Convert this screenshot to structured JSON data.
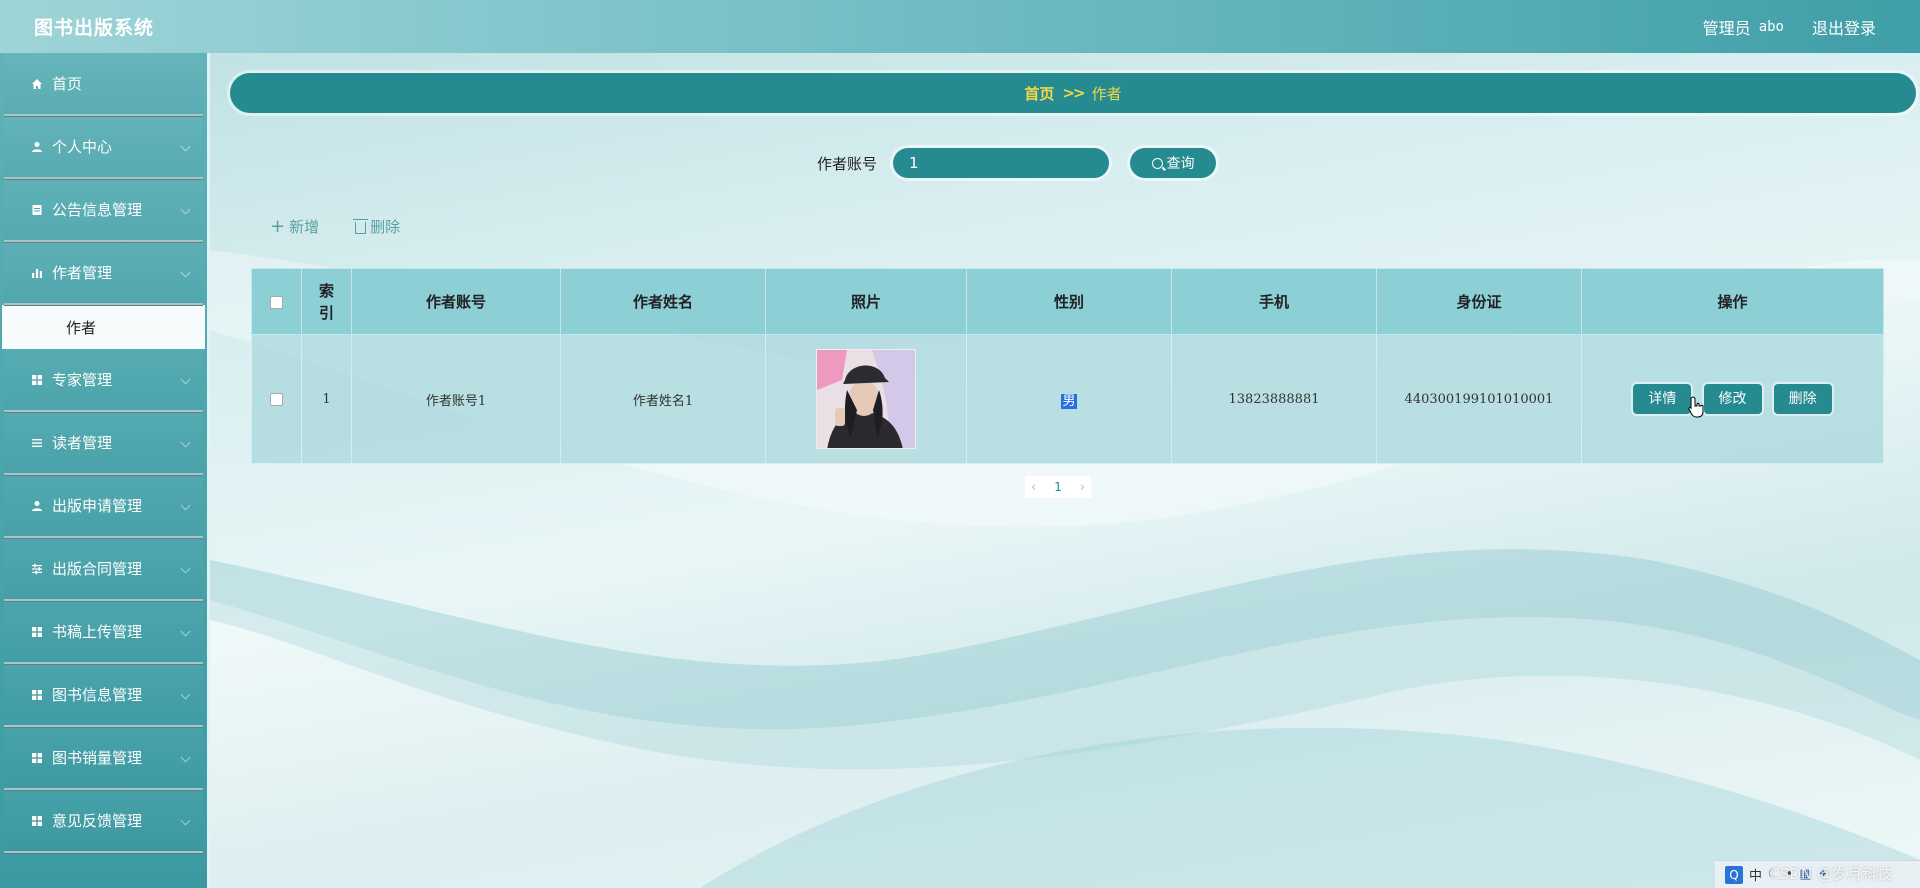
{
  "header": {
    "title": "图书出版系统",
    "admin_label": "管理员",
    "username": "abo",
    "logout": "退出登录"
  },
  "sidebar": {
    "items": [
      {
        "label": "首页",
        "icon": "home-icon",
        "expandable": false
      },
      {
        "label": "个人中心",
        "icon": "user-icon",
        "expandable": true
      },
      {
        "label": "公告信息管理",
        "icon": "document-icon",
        "expandable": true
      },
      {
        "label": "作者管理",
        "icon": "bar-chart-icon",
        "expandable": true,
        "expanded": true,
        "children": [
          {
            "label": "作者"
          }
        ]
      },
      {
        "label": "专家管理",
        "icon": "grid-icon",
        "expandable": true
      },
      {
        "label": "读者管理",
        "icon": "list-icon",
        "expandable": true
      },
      {
        "label": "出版申请管理",
        "icon": "user-icon",
        "expandable": true
      },
      {
        "label": "出版合同管理",
        "icon": "sliders-icon",
        "expandable": true
      },
      {
        "label": "书稿上传管理",
        "icon": "grid-icon",
        "expandable": true
      },
      {
        "label": "图书信息管理",
        "icon": "grid-icon",
        "expandable": true
      },
      {
        "label": "图书销量管理",
        "icon": "grid-icon",
        "expandable": true
      },
      {
        "label": "意见反馈管理",
        "icon": "grid-icon",
        "expandable": true
      }
    ]
  },
  "breadcrumb": {
    "home": "首页",
    "separator": ">>",
    "current": "作者"
  },
  "search": {
    "label": "作者账号",
    "value": "1",
    "button": "查询"
  },
  "toolbar": {
    "add": "新增",
    "delete": "删除"
  },
  "table": {
    "headers": [
      "",
      "索引",
      "作者账号",
      "作者姓名",
      "照片",
      "性别",
      "手机",
      "身份证",
      "操作"
    ],
    "rows": [
      {
        "index": "1",
        "account": "作者账号1",
        "name": "作者姓名1",
        "gender": "男",
        "phone": "13823888881",
        "id_card": "440300199101010001",
        "actions": {
          "detail": "详情",
          "edit": "修改",
          "delete": "删除"
        }
      }
    ]
  },
  "pagination": {
    "current": "1"
  },
  "watermark": "CSDN @岁月科技",
  "tray": {
    "ime": "中"
  },
  "colors": {
    "accent": "#258b90",
    "breadcrumb_text": "#f3d64a",
    "header_bg": "#5db1b9",
    "table_header": "#8ccfd5"
  }
}
